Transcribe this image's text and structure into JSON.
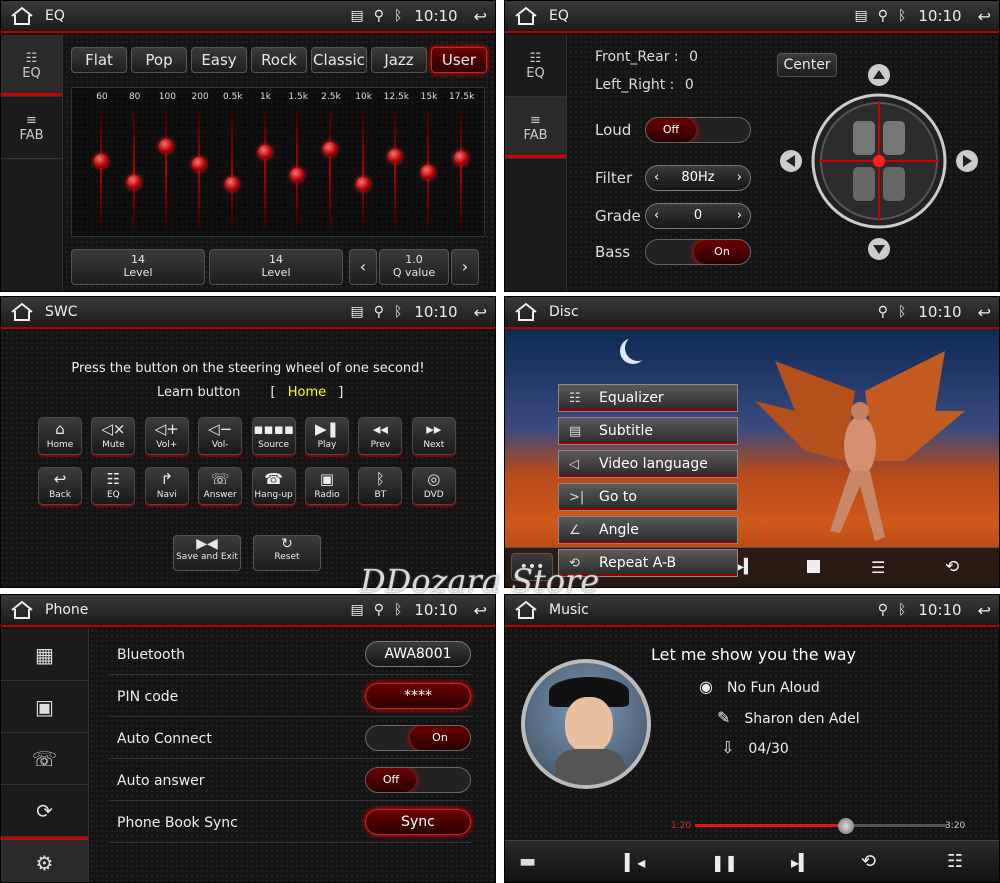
{
  "panels": {
    "eq1": {
      "title": "EQ",
      "time": "10:10",
      "side": [
        "EQ",
        "FAB"
      ],
      "presets": [
        "Flat",
        "Pop",
        "Easy",
        "Rock",
        "Classic",
        "Jazz",
        "User"
      ],
      "active_preset": "User",
      "freqs": [
        "60",
        "80",
        "100",
        "200",
        "0.5k",
        "1k",
        "1.5k",
        "2.5k",
        "10k",
        "12.5k",
        "15k",
        "17.5k"
      ],
      "levels": [
        0.42,
        0.6,
        0.3,
        0.45,
        0.62,
        0.35,
        0.54,
        0.32,
        0.62,
        0.38,
        0.52,
        0.4
      ],
      "bottom": [
        {
          "v": "14",
          "l": "Level"
        },
        {
          "v": "14",
          "l": "Level"
        },
        {
          "v": "1.0",
          "l": "Q value"
        }
      ]
    },
    "eq2": {
      "title": "EQ",
      "time": "10:10",
      "side": [
        "EQ",
        "FAB"
      ],
      "front_rear_label": "Front_Rear :",
      "front_rear": "0",
      "left_right_label": "Left_Right  :",
      "left_right": "0",
      "loud": "Loud",
      "loud_state": "Off",
      "filter": "Filter",
      "filter_val": "80Hz",
      "grade": "Grade",
      "grade_val": "0",
      "bass": "Bass",
      "bass_state": "On",
      "center": "Center"
    },
    "swc": {
      "title": "SWC",
      "time": "10:10",
      "instr": "Press the button on the steering wheel of one second!",
      "learn_label": "Learn button",
      "learn_open": "[",
      "learn_val": "Home",
      "learn_close": "]",
      "row1": [
        "Home",
        "Mute",
        "Vol+",
        "Vol-",
        "Source",
        "Play",
        "Prev",
        "Next"
      ],
      "row2": [
        "Back",
        "EQ",
        "Navi",
        "Answer",
        "Hang-up",
        "Radio",
        "BT",
        "DVD"
      ],
      "save": "Save and Exit",
      "reset": "Reset"
    },
    "disc": {
      "title": "Disc",
      "time": "10:10",
      "menu": [
        "Equalizer",
        "Subtitle",
        "Video language",
        "Go to",
        "Angle",
        "Repeat A-B"
      ]
    },
    "phone": {
      "title": "Phone",
      "time": "10:10",
      "rows": [
        {
          "label": "Bluetooth",
          "value": "AWA8001"
        },
        {
          "label": "PIN code",
          "value": "****"
        },
        {
          "label": "Auto Connect",
          "value": "On"
        },
        {
          "label": "Auto answer",
          "value": "Off"
        },
        {
          "label": "Phone Book Sync",
          "value": "Sync"
        }
      ]
    },
    "music": {
      "title": "Music",
      "time": "10:10",
      "song": "Let me show you the way",
      "album": "No Fun Aloud",
      "artist": "Sharon den Adel",
      "track": "04/30",
      "elapsed": "1:20",
      "total": "3:20",
      "progress": 0.6
    }
  },
  "watermark": "DDozara Store"
}
